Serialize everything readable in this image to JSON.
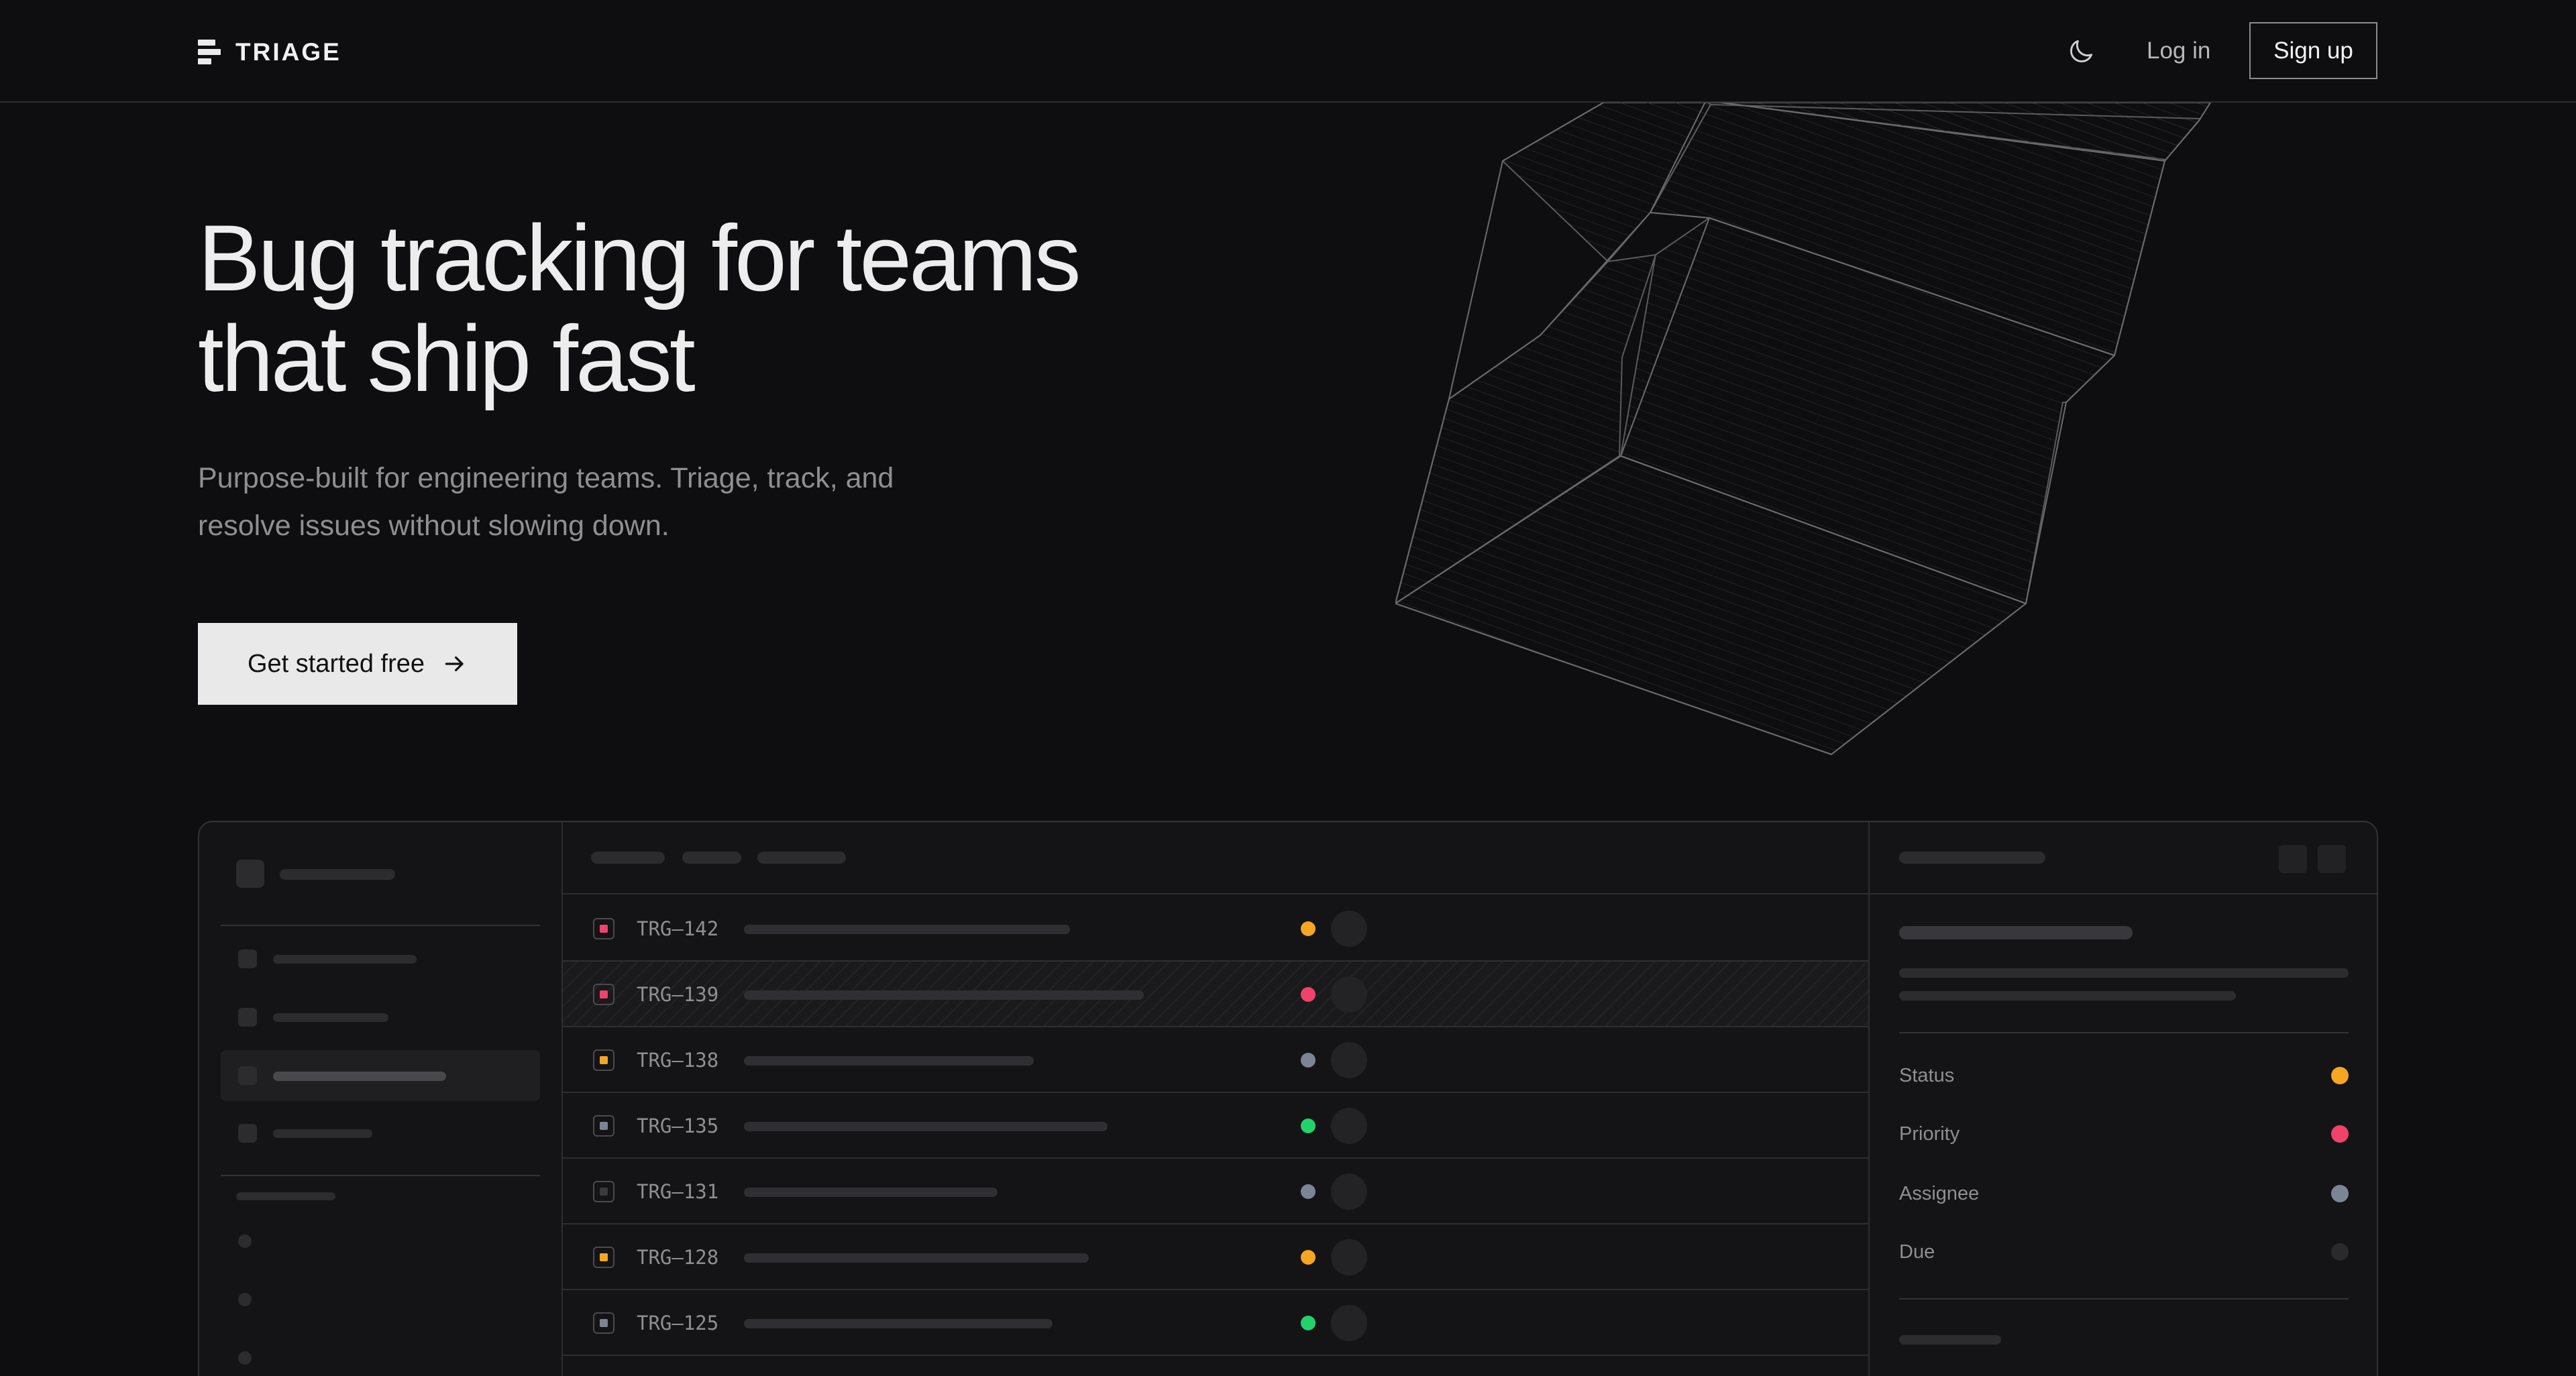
{
  "nav": {
    "brand": "TRIAGE",
    "theme_icon": "moon-icon",
    "login": "Log in",
    "signup": "Sign up"
  },
  "hero": {
    "title_line1": "Bug tracking for teams",
    "title_line2": "that ship fast",
    "subtitle_line1": "Purpose-built for engineering teams. Triage, track, and",
    "subtitle_line2": "resolve issues without slowing down.",
    "cta": "Get started free",
    "cta_icon": "arrow-right-icon"
  },
  "issues": [
    {
      "id": "TRG–142",
      "type_color": "#f0436a",
      "status_color": "#f5a623"
    },
    {
      "id": "TRG–139",
      "type_color": "#f0436a",
      "status_color": "#f0436a"
    },
    {
      "id": "TRG–138",
      "type_color": "#f5a623",
      "status_color": "#7c8595"
    },
    {
      "id": "TRG–135",
      "type_color": "#7c8595",
      "status_color": "#22d36b"
    },
    {
      "id": "TRG–131",
      "type_color": "#3a3a3e",
      "status_color": "#7c8595"
    },
    {
      "id": "TRG–128",
      "type_color": "#f5a623",
      "status_color": "#f5a623"
    },
    {
      "id": "TRG–125",
      "type_color": "#7c8595",
      "status_color": "#22d36b"
    }
  ],
  "detail": {
    "status_label": "Status",
    "status_color": "#f5a623",
    "priority_label": "Priority",
    "priority_color": "#f0436a",
    "assignee_label": "Assignee",
    "assignee_color": "#7c8595",
    "due_label": "Due",
    "due_color": "#2a2a2d"
  },
  "colors": {
    "background": "#0e0e10",
    "panel": "#141416",
    "accent_amber": "#f5a623",
    "accent_red": "#f0436a",
    "accent_green": "#22d36b",
    "accent_slate": "#7c8595"
  }
}
